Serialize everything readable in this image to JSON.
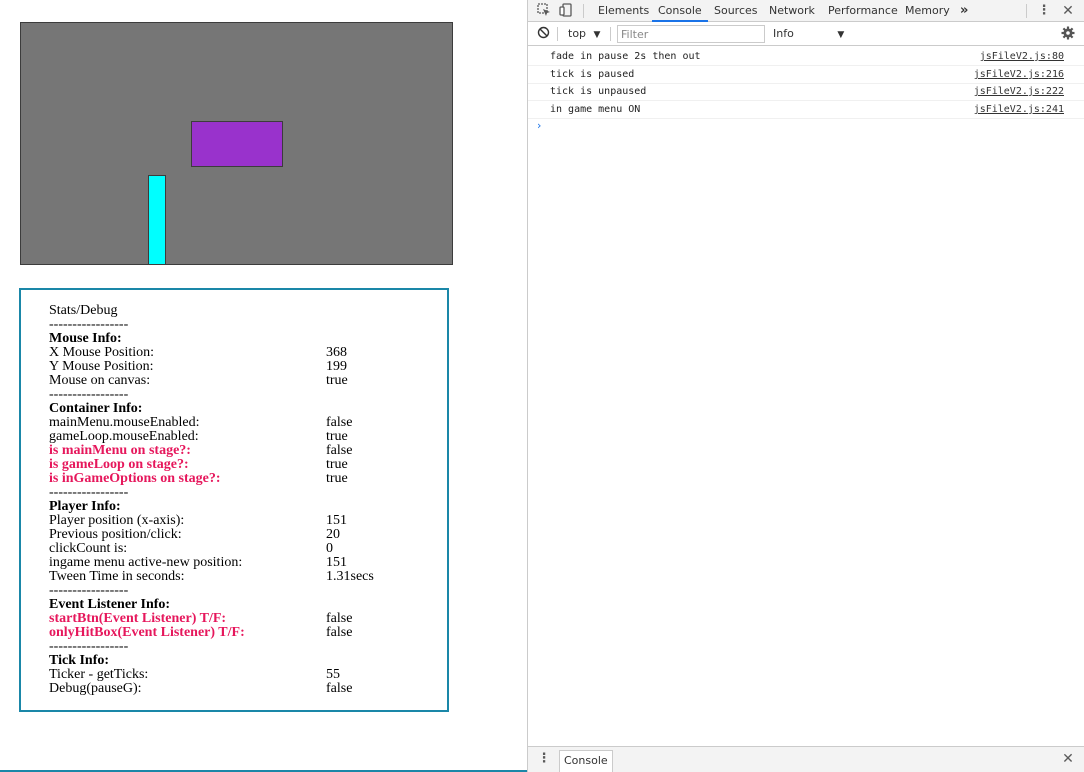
{
  "game": {
    "colors": {
      "canvas": "#767676",
      "enemy": "#9932cc",
      "player": "#00ffff"
    }
  },
  "debug": {
    "title": "Stats/Debug",
    "divider": "-----------------",
    "mouse": {
      "heading": "Mouse Info:",
      "rows": [
        {
          "label": "X Mouse Position:",
          "value": "368"
        },
        {
          "label": "Y Mouse Position:",
          "value": "199"
        },
        {
          "label": "Mouse on canvas:",
          "value": "true"
        }
      ]
    },
    "container": {
      "heading": "Container Info:",
      "rows": [
        {
          "label": "mainMenu.mouseEnabled:",
          "value": "false"
        },
        {
          "label": "gameLoop.mouseEnabled:",
          "value": "true"
        },
        {
          "label": "is mainMenu on stage?:",
          "value": "false"
        },
        {
          "label": "is gameLoop on stage?:",
          "value": "true"
        },
        {
          "label": "is inGameOptions on stage?:",
          "value": "true"
        }
      ]
    },
    "player": {
      "heading": "Player Info:",
      "rows": [
        {
          "label": "Player position (x-axis):",
          "value": "151"
        },
        {
          "label": "Previous position/click:",
          "value": "20"
        },
        {
          "label": "clickCount is:",
          "value": "0"
        },
        {
          "label": "ingame menu active-new position:",
          "value": "151"
        },
        {
          "label": "Tween Time in seconds:",
          "value": "1.31secs"
        }
      ]
    },
    "events": {
      "heading": "Event Listener Info:",
      "rows": [
        {
          "label": "startBtn(Event Listener) T/F:",
          "value": "false"
        },
        {
          "label": "onlyHitBox(Event Listener) T/F:",
          "value": "false"
        }
      ]
    },
    "tick": {
      "heading": "Tick Info:",
      "rows": [
        {
          "label": "Ticker - getTicks:",
          "value": "55"
        },
        {
          "label": "Debug(pauseG):",
          "value": "false"
        }
      ]
    }
  },
  "devtools": {
    "tabs": [
      "Elements",
      "Console",
      "Sources",
      "Network",
      "Performance",
      "Memory"
    ],
    "active_tab": "Console",
    "overflow": "»",
    "context": "top",
    "filter_placeholder": "Filter",
    "level": "Info",
    "logs": [
      {
        "message": "fade in pause 2s then out",
        "source": "jsFileV2.js:80"
      },
      {
        "message": "tick is paused",
        "source": "jsFileV2.js:216"
      },
      {
        "message": "tick is unpaused",
        "source": "jsFileV2.js:222"
      },
      {
        "message": "in game menu ON",
        "source": "jsFileV2.js:241"
      }
    ],
    "prompt": "›",
    "drawer_tab": "Console",
    "accent": "#1a73e8"
  }
}
